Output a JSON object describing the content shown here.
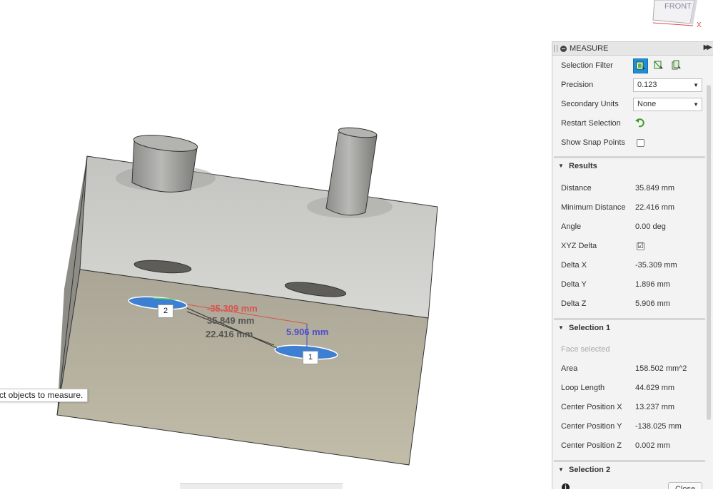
{
  "viewcube": {
    "face_label": "FRONT",
    "axis_label": "X"
  },
  "tooltip": {
    "text": "ct objects to measure."
  },
  "viewport": {
    "labels": {
      "delta_x": "-35.309 mm",
      "distance": "35.849 mm",
      "minimum_distance": "22.416 mm",
      "delta_z": "5.906 mm"
    },
    "markers": [
      "2",
      "1"
    ]
  },
  "panel": {
    "title": "MEASURE",
    "selection_filter_label": "Selection Filter",
    "precision_label": "Precision",
    "precision_value": "0.123",
    "secondary_units_label": "Secondary Units",
    "secondary_units_value": "None",
    "restart_selection_label": "Restart Selection",
    "show_snap_points_label": "Show Snap Points",
    "show_snap_points_checked": false,
    "results": {
      "title": "Results",
      "rows": [
        {
          "label": "Distance",
          "value": "35.849 mm"
        },
        {
          "label": "Minimum Distance",
          "value": "22.416 mm"
        },
        {
          "label": "Angle",
          "value": "0.00 deg"
        },
        {
          "label": "XYZ Delta",
          "value": "☑"
        },
        {
          "label": "Delta X",
          "value": "-35.309 mm"
        },
        {
          "label": "Delta Y",
          "value": "1.896 mm"
        },
        {
          "label": "Delta Z",
          "value": "5.906 mm"
        }
      ]
    },
    "selection1": {
      "title": "Selection 1",
      "status": "Face selected",
      "rows": [
        {
          "label": "Area",
          "value": "158.502 mm^2"
        },
        {
          "label": "Loop Length",
          "value": "44.629 mm"
        },
        {
          "label": "Center Position X",
          "value": "13.237 mm"
        },
        {
          "label": "Center Position Y",
          "value": "-138.025 mm"
        },
        {
          "label": "Center Position Z",
          "value": "0.002 mm"
        }
      ]
    },
    "selection2": {
      "title": "Selection 2"
    },
    "close_label": "Close",
    "accent_color": "#1e8fd6"
  }
}
